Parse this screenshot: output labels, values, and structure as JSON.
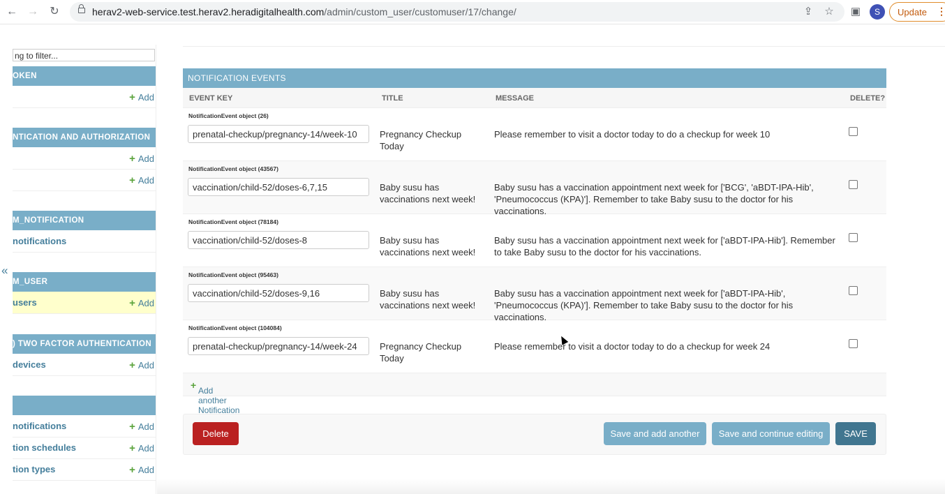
{
  "browser": {
    "url_host": "herav2-web-service.test.herav2.heradigitalhealth.com",
    "url_path": "/admin/custom_user/customuser/17/change/",
    "avatar_letter": "S",
    "update_label": "Update"
  },
  "sidebar": {
    "filter_placeholder": "ng to filter...",
    "collapse_label": "«",
    "add_label": "Add",
    "modules": [
      {
        "header": "OKEN",
        "rows": [
          {
            "label": "",
            "add": true
          }
        ]
      },
      {
        "header": "NTICATION AND AUTHORIZATION",
        "rows": [
          {
            "label": "",
            "add": true
          },
          {
            "label": "",
            "add": true
          }
        ]
      },
      {
        "header": "M_NOTIFICATION",
        "rows": [
          {
            "label": "notifications",
            "add": false
          }
        ]
      },
      {
        "header": "M_USER",
        "rows": [
          {
            "label": "users",
            "add": true
          }
        ]
      },
      {
        "header": ") TWO FACTOR AUTHENTICATION",
        "rows": [
          {
            "label": "devices",
            "add": true
          }
        ]
      },
      {
        "header": "",
        "rows": [
          {
            "label": "notifications",
            "add": true
          },
          {
            "label": "tion schedules",
            "add": true
          },
          {
            "label": "tion types",
            "add": true
          }
        ]
      }
    ]
  },
  "inline": {
    "caption": "NOTIFICATION EVENTS",
    "columns": [
      "EVENT KEY",
      "TITLE",
      "MESSAGE",
      "DELETE?"
    ],
    "rows": [
      {
        "object": "NotificationEvent object (26)",
        "key": "prenatal-checkup/pregnancy-14/week-10",
        "title": "Pregnancy Checkup Today",
        "message": "Please remember to visit a doctor today to do a checkup for week 10"
      },
      {
        "object": "NotificationEvent object (43567)",
        "key": "vaccination/child-52/doses-6,7,15",
        "title": "Baby susu has vaccinations next week!",
        "message": "Baby susu has a vaccination appointment next week for ['BCG', 'aBDT-IPA-Hib', 'Pneumococcus (KPA)']. Remember to take Baby susu to the doctor for his vaccinations."
      },
      {
        "object": "NotificationEvent object (78184)",
        "key": "vaccination/child-52/doses-8",
        "title": "Baby susu has vaccinations next week!",
        "message": "Baby susu has a vaccination appointment next week for ['aBDT-IPA-Hib']. Remember to take Baby susu to the doctor for his vaccinations."
      },
      {
        "object": "NotificationEvent object (95463)",
        "key": "vaccination/child-52/doses-9,16",
        "title": "Baby susu has vaccinations next week!",
        "message": "Baby susu has a vaccination appointment next week for ['aBDT-IPA-Hib', 'Pneumococcus (KPA)']. Remember to take Baby susu to the doctor for his vaccinations."
      },
      {
        "object": "NotificationEvent object (104084)",
        "key": "prenatal-checkup/pregnancy-14/week-24",
        "title": "Pregnancy Checkup Today",
        "message": "Please remember to visit a doctor today to do a checkup for week 24"
      }
    ],
    "add_another": "Add another Notification event"
  },
  "submit": {
    "delete": "Delete",
    "save_add": "Save and add another",
    "save_continue": "Save and continue editing",
    "save": "SAVE"
  },
  "colors": {
    "header": "#79aec8",
    "link": "#447e9b",
    "delete": "#ba2121",
    "save": "#417690",
    "add": "#5aa33b"
  }
}
